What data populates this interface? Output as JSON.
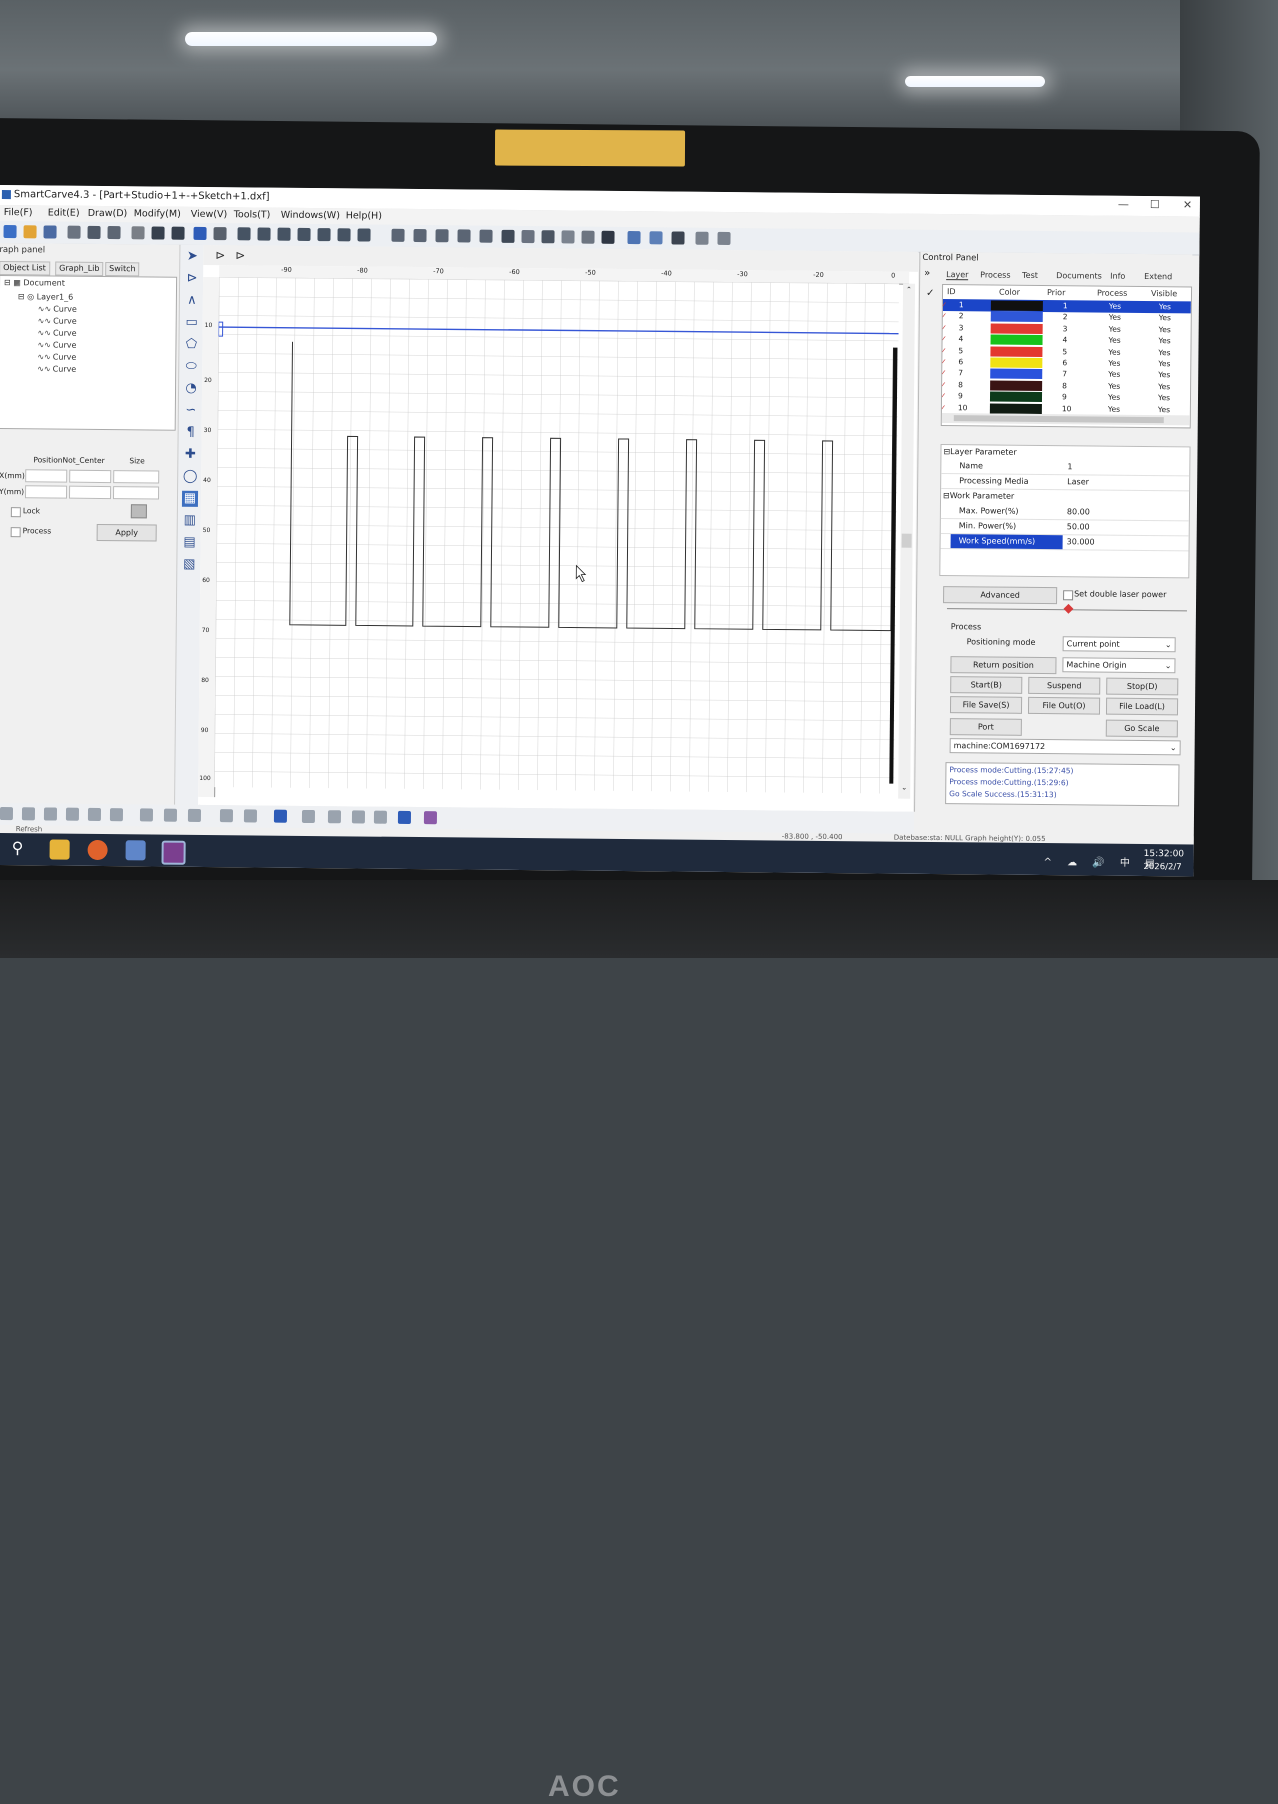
{
  "window": {
    "title": "SmartCarve4.3 - [Part+Studio+1+-+Sketch+1.dxf]",
    "minimize": "—",
    "maximize": "☐",
    "close": "✕"
  },
  "menu": [
    "File(F)",
    "Edit(E)",
    "Draw(D)",
    "Modify(M)",
    "View(V)",
    "Tools(T)",
    "Windows(W)",
    "Help(H)"
  ],
  "left_panel": {
    "label": "raph panel",
    "tabs": [
      "Object List",
      "Graph_Lib",
      "Switch"
    ],
    "tree": {
      "root": "Document",
      "layer": "Layer1_6",
      "items": [
        "Curve",
        "Curve",
        "Curve",
        "Curve",
        "Curve",
        "Curve"
      ]
    },
    "position": {
      "headers": [
        "Position",
        "Not_Center",
        "Size"
      ],
      "x_label": "X(mm)",
      "y_label": "Y(mm)",
      "lock_label": "Lock",
      "process_label": "Process",
      "apply_label": "Apply"
    }
  },
  "ruler": {
    "h_ticks": [
      "-90",
      "-80",
      "-70",
      "-60",
      "-50",
      "-40",
      "-30",
      "-20",
      "0"
    ],
    "v_ticks": [
      "10",
      "20",
      "30",
      "40",
      "50",
      "60",
      "70",
      "80",
      "90",
      "100"
    ]
  },
  "control_panel": {
    "title": "Control Panel",
    "tabs": [
      "Layer",
      "Process",
      "Test",
      "Documents",
      "Info",
      "Extend"
    ],
    "layer_table": {
      "headers": [
        "ID",
        "Color",
        "Prior",
        "Process",
        "Visible"
      ],
      "rows": [
        {
          "id": "1",
          "color": "#101010",
          "prior": "1",
          "process": "Yes",
          "visible": "Yes"
        },
        {
          "id": "2",
          "color": "#2f57d8",
          "prior": "2",
          "process": "Yes",
          "visible": "Yes"
        },
        {
          "id": "3",
          "color": "#e23a32",
          "prior": "3",
          "process": "Yes",
          "visible": "Yes"
        },
        {
          "id": "4",
          "color": "#17c21b",
          "prior": "4",
          "process": "Yes",
          "visible": "Yes"
        },
        {
          "id": "5",
          "color": "#e3382f",
          "prior": "5",
          "process": "Yes",
          "visible": "Yes"
        },
        {
          "id": "6",
          "color": "#f0e214",
          "prior": "6",
          "process": "Yes",
          "visible": "Yes"
        },
        {
          "id": "7",
          "color": "#2a52dc",
          "prior": "7",
          "process": "Yes",
          "visible": "Yes"
        },
        {
          "id": "8",
          "color": "#3a1414",
          "prior": "8",
          "process": "Yes",
          "visible": "Yes"
        },
        {
          "id": "9",
          "color": "#0d3a1a",
          "prior": "9",
          "process": "Yes",
          "visible": "Yes"
        },
        {
          "id": "10",
          "color": "#101b12",
          "prior": "10",
          "process": "Yes",
          "visible": "Yes"
        }
      ]
    },
    "layer_parameter": {
      "section": "Layer Parameter",
      "name_label": "Name",
      "name_value": "1",
      "media_label": "Processing Media",
      "media_value": "Laser"
    },
    "work_parameter": {
      "section": "Work Parameter",
      "max_power_label": "Max. Power(%)",
      "max_power_value": "80.00",
      "min_power_label": "Min. Power(%)",
      "min_power_value": "50.00",
      "speed_label": "Work Speed(mm/s)",
      "speed_value": "30.000"
    },
    "advanced_label": "Advanced",
    "double_laser_label": "Set double laser power",
    "process": {
      "section": "Process",
      "positioning_label": "Positioning mode",
      "positioning_value": "Current point",
      "return_label": "Return position",
      "return_value": "Machine Origin",
      "start": "Start(B)",
      "suspend": "Suspend",
      "stop": "Stop(D)",
      "file_save": "File Save(S)",
      "file_out": "File Out(O)",
      "file_load": "File Load(L)",
      "port": "Port",
      "go_scale": "Go Scale",
      "machine": "machine:COM1697172"
    },
    "log": [
      "Process mode:Cutting.(15:27:45)",
      "Process mode:Cutting.(15:29:6)",
      "Go Scale Success.(15:31:13)"
    ]
  },
  "status": {
    "refresh": "Refresh",
    "coords": "-83.800 , -50.400",
    "info": "Datebase:sta: NULL Graph height(Y): 0.055"
  },
  "taskbar": {
    "time": "15:32:00",
    "date": "2026/2/7",
    "tray": "^ ☁ 🔊 中 ▤"
  },
  "monitor_brand": "AOC",
  "colors": {
    "selection": "#1b45c8",
    "canvas_blue_line": "#3656d6"
  }
}
